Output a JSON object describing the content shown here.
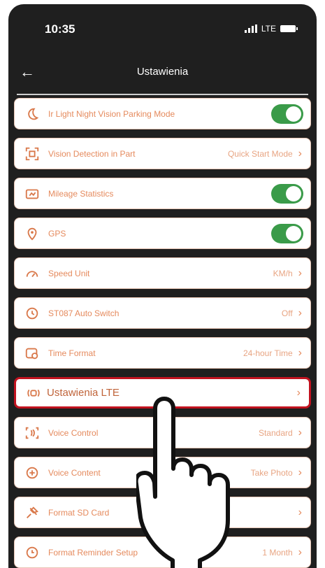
{
  "status": {
    "time": "10:35",
    "network": "LTE"
  },
  "nav": {
    "back_glyph": "←",
    "title": "Ustawienia"
  },
  "items": [
    {
      "label": "Ir Light Night Vision Parking Mode",
      "control": "toggle",
      "on": true,
      "icon": "moon-icon"
    },
    {
      "label": "Vision Detection in Part",
      "value": "Quick Start Mode",
      "chevron": "›",
      "icon": "scan-icon"
    },
    {
      "label": "Mileage Statistics",
      "control": "toggle",
      "on": true,
      "icon": "dashboard-icon"
    },
    {
      "label": "GPS",
      "control": "toggle",
      "on": true,
      "icon": "gps-icon"
    },
    {
      "label": "Speed Unit",
      "value": "KM/h",
      "chevron": "›",
      "icon": "speedometer-icon"
    },
    {
      "label": "ST087 Auto Switch",
      "value": "Off",
      "chevron": "›",
      "icon": "clock-icon"
    },
    {
      "label": "Time Format",
      "value": "24-hour Time",
      "chevron": "›",
      "icon": "time-format-icon"
    },
    {
      "label": "Ustawienia LTE",
      "value": "",
      "chevron": "›",
      "icon": "lte-icon"
    },
    {
      "label": "Voice Control",
      "value": "Standard",
      "chevron": "›",
      "icon": "voice-icon"
    },
    {
      "label": "Voice Content",
      "value": "Take Photo",
      "chevron": "›",
      "icon": "voice-content-icon"
    },
    {
      "label": "Format SD Card",
      "value": "",
      "chevron": "›",
      "icon": "sd-card-icon"
    },
    {
      "label": "Format Reminder Setup",
      "value": "1 Month",
      "chevron": "›",
      "icon": "reminder-icon"
    }
  ],
  "colors": {
    "accent": "#e58a5d",
    "toggle_on": "#3a9b49",
    "highlight": "#c1121f",
    "background": "#1f1f1f"
  }
}
